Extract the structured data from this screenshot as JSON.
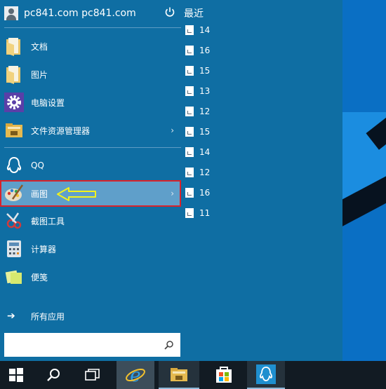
{
  "user": {
    "name": "pc841.com pc841.com"
  },
  "power_icon": "power-icon",
  "recent": {
    "label": "最近",
    "items": [
      "14",
      "16",
      "15",
      "13",
      "12",
      "15",
      "14",
      "12",
      "16",
      "11"
    ]
  },
  "apps": [
    {
      "label": "文档",
      "icon": "folder-icon"
    },
    {
      "label": "图片",
      "icon": "folder-icon"
    },
    {
      "label": "电脑设置",
      "icon": "gear-icon"
    },
    {
      "label": "文件资源管理器",
      "icon": "file-explorer-icon",
      "chevron": "›"
    },
    {
      "label": "QQ",
      "icon": "qq-icon"
    },
    {
      "label": "画图",
      "icon": "paint-icon",
      "chevron": "›"
    },
    {
      "label": "截图工具",
      "icon": "snipping-icon"
    },
    {
      "label": "计算器",
      "icon": "calculator-icon"
    },
    {
      "label": "便笺",
      "icon": "sticky-notes-icon"
    }
  ],
  "all_apps": {
    "arrow": "➔",
    "label": "所有应用"
  },
  "search": {
    "placeholder": "",
    "value": ""
  },
  "colors": {
    "menu_bg": "#0f6ea3",
    "highlight": "#5f9fca",
    "annotation_box": "#d9222a",
    "annotation_arrow": "#f2f21a",
    "taskbar": "#121b23"
  },
  "taskbar": [
    "start-icon",
    "search-icon",
    "task-view-icon",
    "internet-explorer-icon",
    "file-explorer-icon",
    "store-icon",
    "qq-icon"
  ]
}
